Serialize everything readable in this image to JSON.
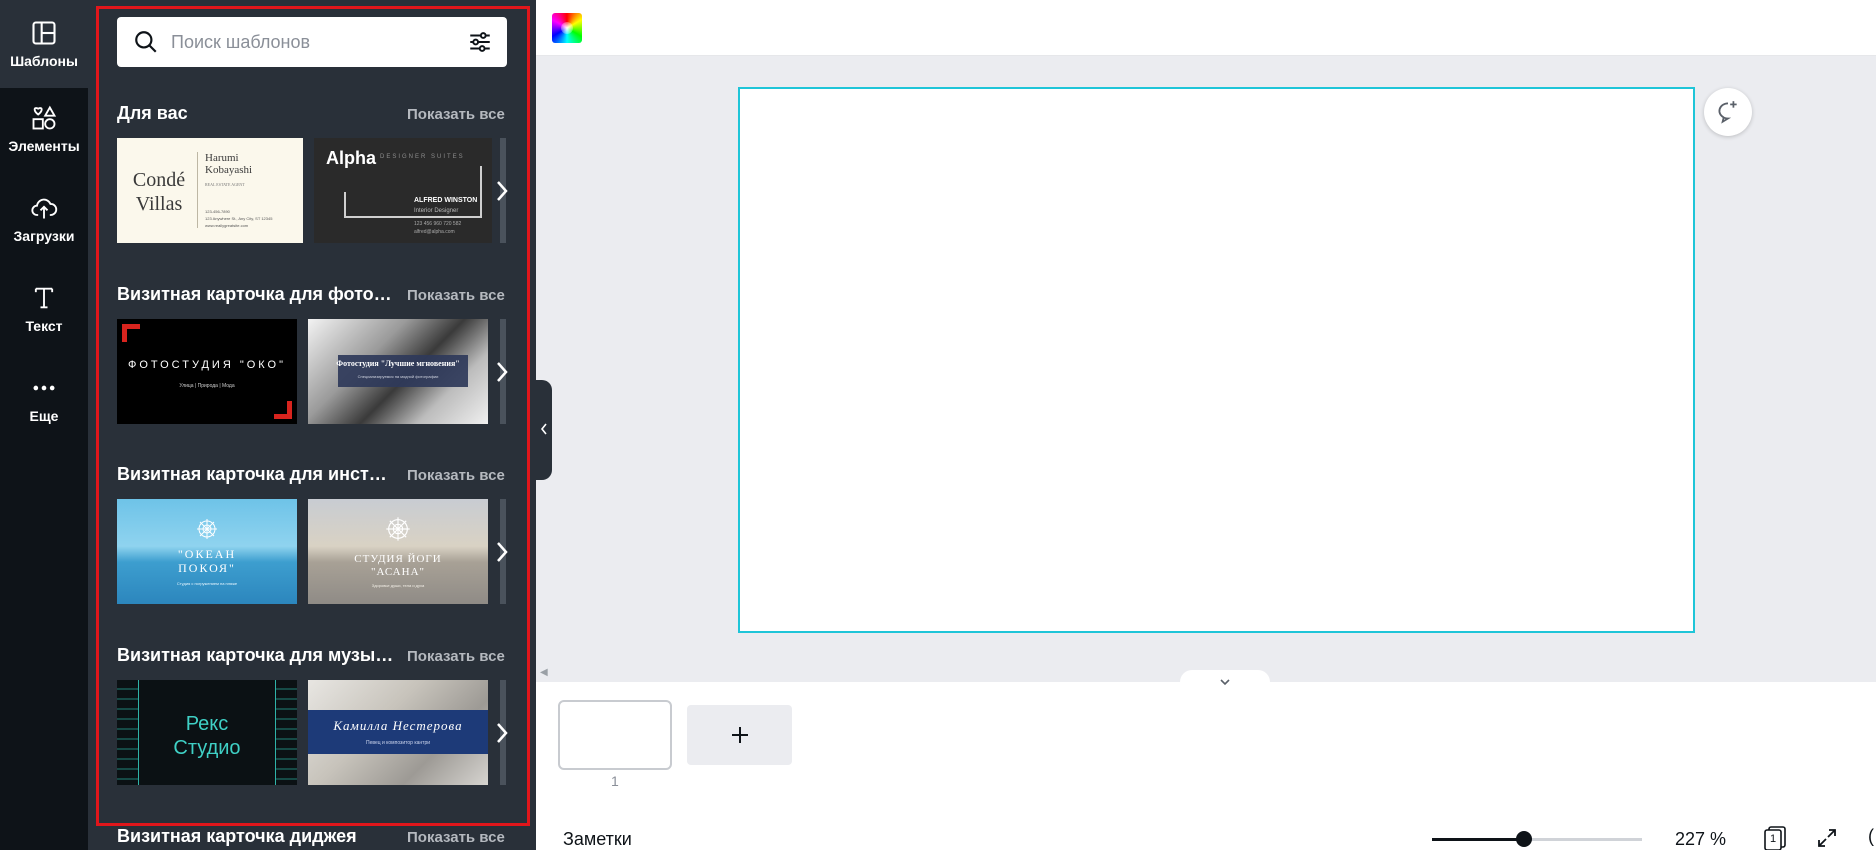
{
  "rail": {
    "items": [
      {
        "label": "Шаблоны",
        "icon": "templates-icon"
      },
      {
        "label": "Элементы",
        "icon": "elements-icon"
      },
      {
        "label": "Загрузки",
        "icon": "upload-cloud-icon"
      },
      {
        "label": "Текст",
        "icon": "text-icon"
      },
      {
        "label": "Еще",
        "icon": "more-dots-icon"
      }
    ]
  },
  "search": {
    "placeholder": "Поиск шаблонов"
  },
  "sections": [
    {
      "title": "Для вас",
      "show_all": "Показать все",
      "thumbs": [
        {
          "lines": [
            "Condé",
            "Villas",
            "Harumi",
            "Kobayashi",
            "REAL ESTATE AGENT",
            "123-456-7890",
            "123 Anywhere St., Any City, ST 12345",
            "www.reallygreatsite.com"
          ]
        },
        {
          "lines": [
            "Alpha",
            "DESIGNER SUITES",
            "ALFRED WINSTON",
            "Interior Designer",
            "123 456 960 720 582",
            "alfred@alpha.com"
          ]
        }
      ]
    },
    {
      "title": "Визитная карточка для фотографа",
      "show_all": "Показать все",
      "thumbs": [
        {
          "lines": [
            "ФОТОСТУДИЯ \"ОКО\"",
            "Улица | Природа | Мода"
          ]
        },
        {
          "lines": [
            "Фотостудия \"Лучшие мгновения\"",
            "Специализируемся на модной фотографии"
          ]
        }
      ]
    },
    {
      "title": "Визитная карточка для инструктора",
      "show_all": "Показать все",
      "thumbs": [
        {
          "lines": [
            "\"ОКЕАН",
            "ПОКОЯ\"",
            "Студия с погружением на пляже"
          ]
        },
        {
          "lines": [
            "СТУДИЯ ЙОГИ",
            "\"АСАНА\"",
            "Здоровье души, тела и духа"
          ]
        }
      ]
    },
    {
      "title": "Визитная карточка для музыканта",
      "show_all": "Показать все",
      "thumbs": [
        {
          "lines": [
            "Рекс",
            "Студио"
          ]
        },
        {
          "lines": [
            "Камилла Нестерова",
            "Певец и композитор кантри"
          ]
        }
      ]
    },
    {
      "title": "Визитная карточка диджея",
      "show_all": "Показать все",
      "thumbs": []
    }
  ],
  "canvas": {
    "page_number": "1"
  },
  "bottom": {
    "notes_label": "Заметки",
    "zoom": "227 %",
    "zoom_fraction": 0.44,
    "pages_count": "1",
    "help_partial": "("
  },
  "colors": {
    "rail_bg": "#0e1318",
    "panel_bg": "#293039",
    "accent_selection": "#1fc5d8",
    "highlight_border": "#e1161b"
  }
}
